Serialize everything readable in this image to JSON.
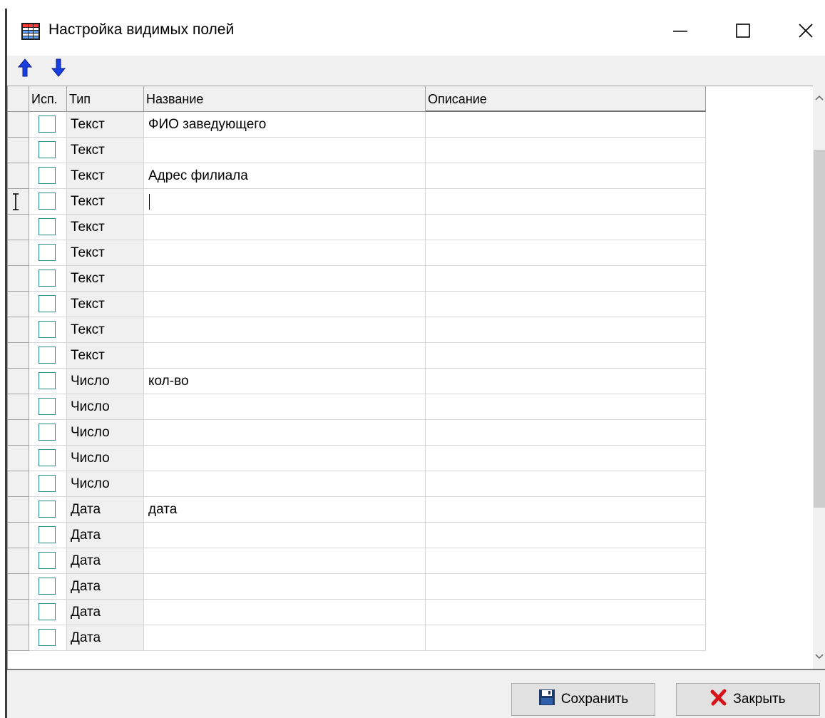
{
  "window": {
    "title": "Настройка видимых полей",
    "minimize_glyph": "—",
    "maximize_glyph": "☐",
    "close_glyph": "✕"
  },
  "toolbar": {
    "move_up_icon": "arrow-up-icon",
    "move_down_icon": "arrow-down-icon"
  },
  "grid": {
    "columns": [
      "Исп.",
      "Тип",
      "Название",
      "Описание"
    ],
    "rows": [
      {
        "used": false,
        "type": "Текст",
        "name": "ФИО заведующего",
        "description": ""
      },
      {
        "used": false,
        "type": "Текст",
        "name": "",
        "description": ""
      },
      {
        "used": false,
        "type": "Текст",
        "name": "Адрес филиала",
        "description": ""
      },
      {
        "used": false,
        "type": "Текст",
        "name": "",
        "description": "",
        "active": true
      },
      {
        "used": false,
        "type": "Текст",
        "name": "",
        "description": ""
      },
      {
        "used": false,
        "type": "Текст",
        "name": "",
        "description": ""
      },
      {
        "used": false,
        "type": "Текст",
        "name": "",
        "description": ""
      },
      {
        "used": false,
        "type": "Текст",
        "name": "",
        "description": ""
      },
      {
        "used": false,
        "type": "Текст",
        "name": "",
        "description": ""
      },
      {
        "used": false,
        "type": "Текст",
        "name": "",
        "description": ""
      },
      {
        "used": false,
        "type": "Число",
        "name": "кол-во",
        "description": ""
      },
      {
        "used": false,
        "type": "Число",
        "name": "",
        "description": ""
      },
      {
        "used": false,
        "type": "Число",
        "name": "",
        "description": ""
      },
      {
        "used": false,
        "type": "Число",
        "name": "",
        "description": ""
      },
      {
        "used": false,
        "type": "Число",
        "name": "",
        "description": ""
      },
      {
        "used": false,
        "type": "Дата",
        "name": "дата",
        "description": ""
      },
      {
        "used": false,
        "type": "Дата",
        "name": "",
        "description": ""
      },
      {
        "used": false,
        "type": "Дата",
        "name": "",
        "description": ""
      },
      {
        "used": false,
        "type": "Дата",
        "name": "",
        "description": ""
      },
      {
        "used": false,
        "type": "Дата",
        "name": "",
        "description": ""
      },
      {
        "used": false,
        "type": "Дата",
        "name": "",
        "description": ""
      }
    ]
  },
  "buttons": {
    "save_label": "Сохранить",
    "save_icon": "floppy-disk-icon",
    "close_label": "Закрыть",
    "close_icon": "red-x-icon"
  },
  "colors": {
    "arrow_blue": "#1a3fe0",
    "checkbox_border": "#2a8c8c",
    "close_red": "#d4141a",
    "floppy_navy": "#1d3a6b"
  }
}
